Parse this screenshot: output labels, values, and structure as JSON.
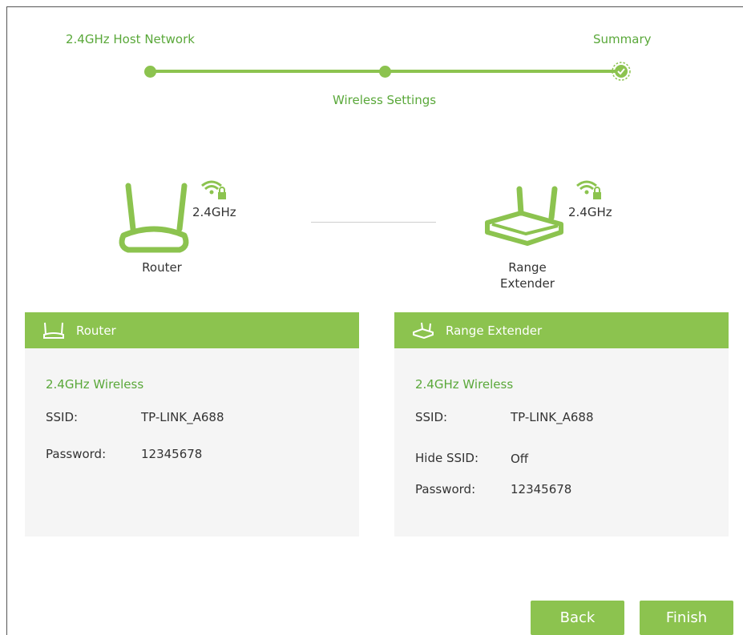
{
  "stepper": {
    "steps": [
      {
        "label": "2.4GHz Host Network"
      },
      {
        "label": "Wireless Settings"
      },
      {
        "label": "Summary"
      }
    ]
  },
  "topology": {
    "router": {
      "freq": "2.4GHz",
      "label": "Router",
      "icon": "router-icon"
    },
    "extender": {
      "freq": "2.4GHz",
      "label_line1": "Range",
      "label_line2": "Extender",
      "icon": "range-extender-icon"
    }
  },
  "router_card": {
    "title": "Router",
    "section": "2.4GHz Wireless",
    "ssid_label": "SSID:",
    "ssid_value": "TP-LINK_A688",
    "password_label": "Password:",
    "password_value": "12345678"
  },
  "extender_card": {
    "title": "Range Extender",
    "section": "2.4GHz Wireless",
    "ssid_label": "SSID:",
    "ssid_value": "TP-LINK_A688",
    "hide_label": "Hide SSID:",
    "hide_value": "Off",
    "password_label": "Password:",
    "password_value": "12345678"
  },
  "buttons": {
    "back": "Back",
    "finish": "Finish"
  },
  "colors": {
    "accent": "#8cc34f",
    "accent_text": "#5aa83a",
    "card_bg": "#f5f5f5"
  }
}
